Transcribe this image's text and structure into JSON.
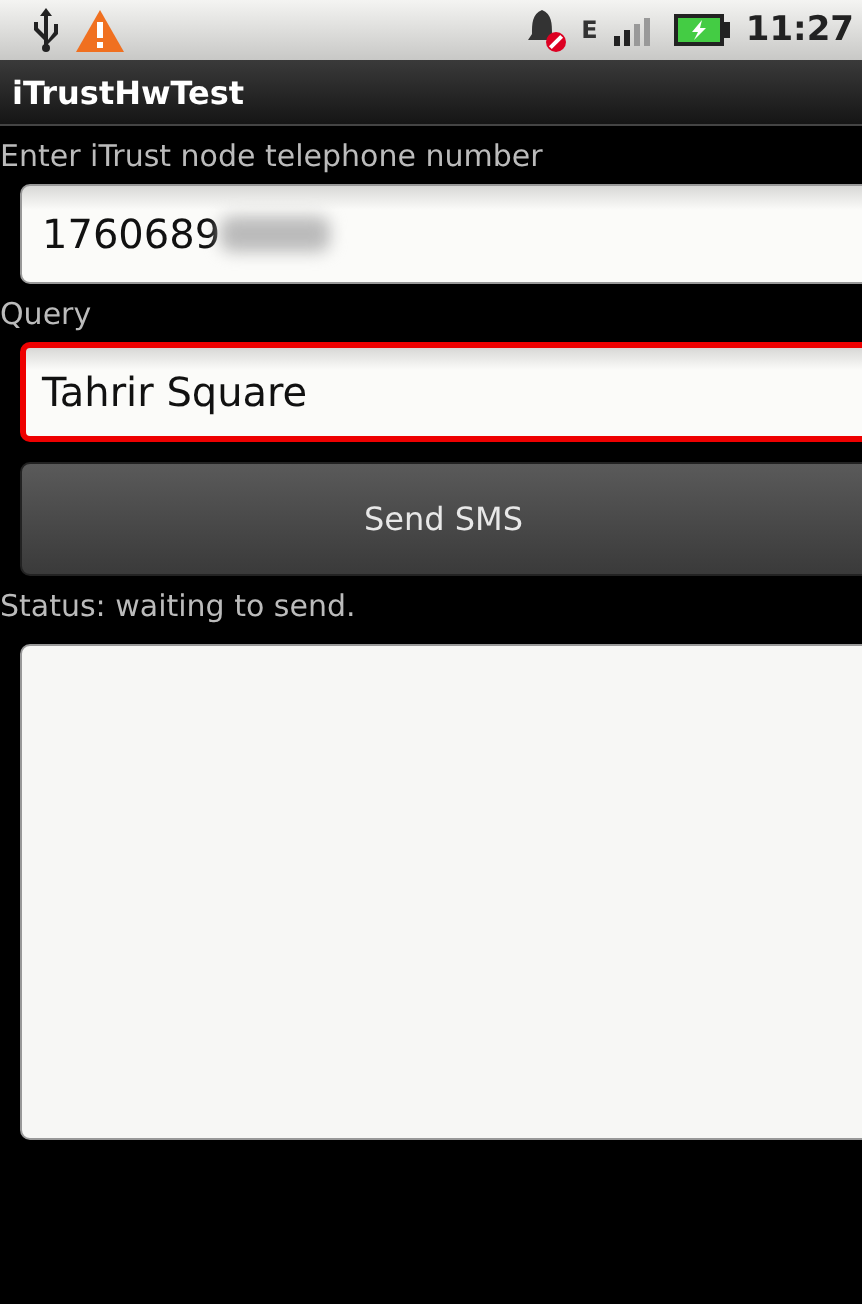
{
  "status_bar": {
    "time": "11:27",
    "network": "E"
  },
  "window": {
    "title": "iTrustHwTest"
  },
  "phone": {
    "label": "Enter iTrust node telephone number",
    "value": "1760689",
    "focused": false,
    "redacted": true
  },
  "query": {
    "label": "Query",
    "value": "Tahrir Square",
    "focused": true
  },
  "send_button": {
    "label": "Send SMS"
  },
  "status": {
    "text": "Status: waiting to send."
  }
}
